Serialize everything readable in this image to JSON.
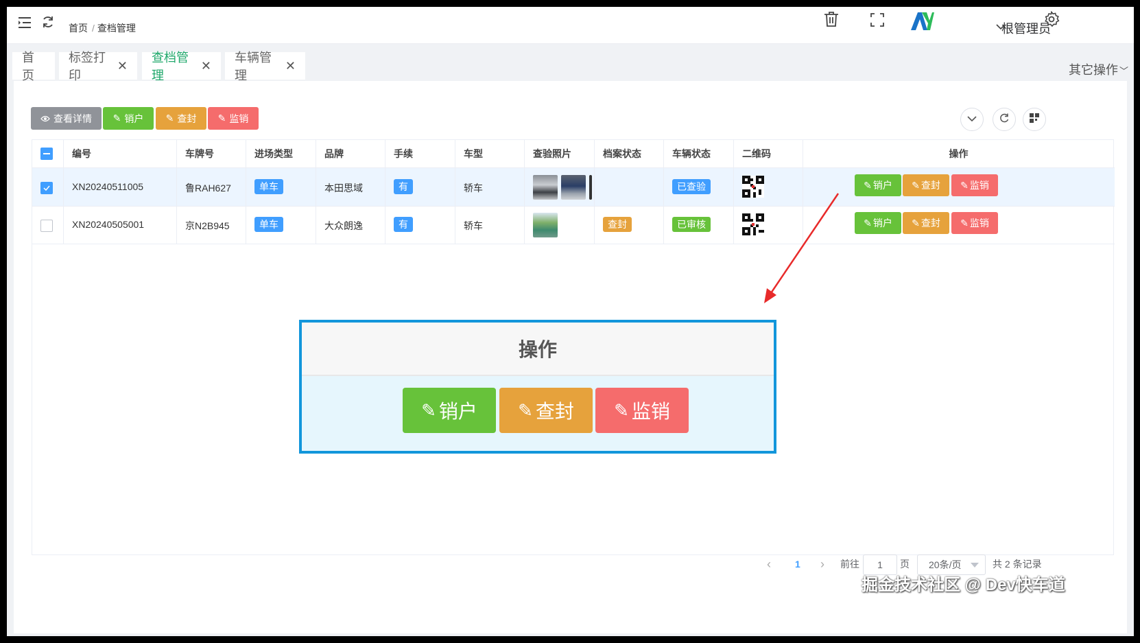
{
  "header": {
    "breadcrumb": [
      "首页",
      "查档管理"
    ],
    "user_name": "根管理员",
    "logo_text": "AY"
  },
  "tabs": [
    {
      "label": "首页",
      "active": false,
      "closable": false
    },
    {
      "label": "标签打印",
      "active": false,
      "closable": true
    },
    {
      "label": "查档管理",
      "active": true,
      "closable": true
    },
    {
      "label": "车辆管理",
      "active": false,
      "closable": true
    }
  ],
  "other_ops": "其它操作",
  "toolbar": {
    "view_detail": "查看详情",
    "cancel_account": "销户",
    "seal": "查封",
    "supervise_cancel": "监销"
  },
  "table": {
    "columns": [
      "编号",
      "车牌号",
      "进场类型",
      "品牌",
      "手续",
      "车型",
      "查验照片",
      "档案状态",
      "车辆状态",
      "二维码",
      "操作"
    ],
    "rows": [
      {
        "checked": true,
        "id": "XN20240511005",
        "plate": "鲁RAH627",
        "entry_type": "单车",
        "brand": "本田思域",
        "procedure": "有",
        "model": "轿车",
        "archive_status": "",
        "vehicle_status": "已查验",
        "vehicle_status_color": "#409eff"
      },
      {
        "checked": false,
        "id": "XN20240505001",
        "plate": "京N2B945",
        "entry_type": "单车",
        "brand": "大众朗逸",
        "procedure": "有",
        "model": "轿车",
        "archive_status": "查封",
        "vehicle_status": "已审核",
        "vehicle_status_color": "#67c23a"
      }
    ],
    "ops": [
      "销户",
      "查封",
      "监销"
    ]
  },
  "callout": {
    "title": "操作",
    "buttons": [
      "销户",
      "查封",
      "监销"
    ]
  },
  "pagination": {
    "current": "1",
    "goto_label": "前往",
    "goto_value": "1",
    "page_unit": "页",
    "page_size": "20条/页",
    "total": "共 2 条记录"
  },
  "watermark": "掘金技术社区 @ Dev快车道",
  "colors": {
    "green": "#67c23a",
    "orange": "#e6a23c",
    "red": "#f56c6c",
    "blue": "#409eff",
    "active_tab": "#20a86b",
    "callout_border": "#1296db"
  }
}
